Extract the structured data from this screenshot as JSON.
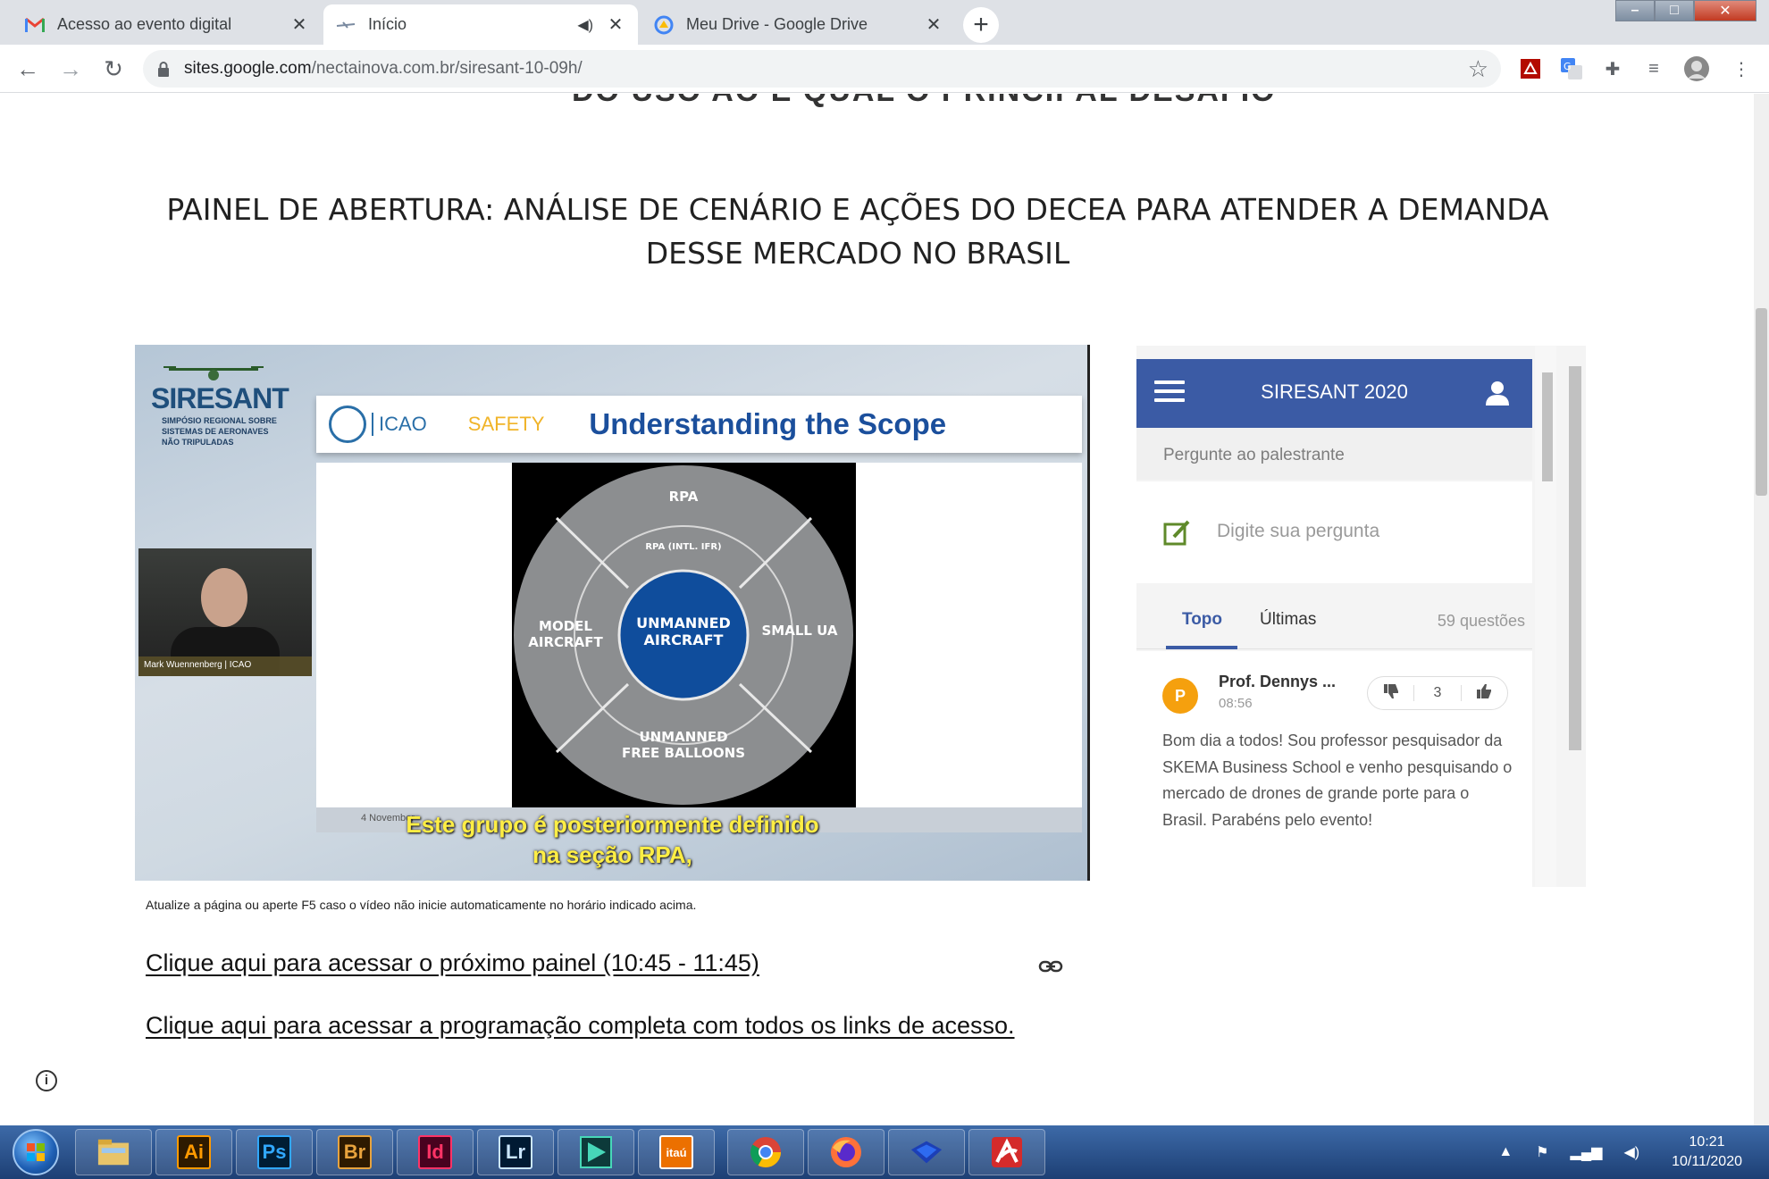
{
  "tabs": [
    {
      "title": "Acesso ao evento digital",
      "favicon": "gmail-icon",
      "active": false
    },
    {
      "title": "Início",
      "favicon": "sites-icon",
      "active": true
    },
    {
      "title": "Meu Drive - Google Drive",
      "favicon": "drive-icon",
      "active": false
    }
  ],
  "address": {
    "host": "sites.google.com",
    "path": "/nectainova.com.br/siresant-10-09h/"
  },
  "page": {
    "cut_heading": "DO USO AO E QUAL O PRINCIPAL DESAFIO",
    "heading": "PAINEL DE ABERTURA: ANÁLISE DE CENÁRIO E AÇÕES DO DECEA PARA ATENDER A DEMANDA DESSE MERCADO NO BRASIL",
    "notice": "Atualize a página ou aperte F5 caso o vídeo não inicie automaticamente no horário indicado acima.",
    "link_next_panel": "Clique aqui para acessar o próximo painel (10:45 - 11:45)",
    "link_program": "Clique aqui para acessar a programação completa com todos os links de acesso."
  },
  "video": {
    "logo_name": "SIRESANT",
    "logo_sub_1": "SIMPÓSIO REGIONAL SOBRE",
    "logo_sub_2": "SISTEMAS DE AERONAVES",
    "logo_sub_3": "NÃO TRIPULADAS",
    "speaker_caption": "Mark Wuennenberg | ICAO",
    "slide_org": "ICAO",
    "slide_tag": "SAFETY",
    "slide_title": "Understanding the Scope",
    "slide_footer": "4 November",
    "subtitle_line1": "Este grupo é posteriormente definido",
    "subtitle_line2": "na seção RPA,",
    "diagram": {
      "center": [
        "UNMANNED",
        "AIRCRAFT"
      ],
      "top": "RPA",
      "inner_top": "RPA (INTL. IFR)",
      "left": [
        "MODEL",
        "AIRCRAFT"
      ],
      "right": "SMALL UA",
      "bottom": [
        "UNMANNED",
        "FREE BALLOONS"
      ]
    }
  },
  "qa": {
    "title": "SIRESANT 2020",
    "ask_label": "Pergunte ao palestrante",
    "input_placeholder": "Digite sua pergunta",
    "tab_top": "Topo",
    "tab_latest": "Últimas",
    "count": "59 questões",
    "question": {
      "avatar": "P",
      "author": "Prof. Dennys ...",
      "time": "08:56",
      "votes": "3",
      "text": "Bom dia a todos! Sou professor pesquisador da SKEMA Business School e venho pesquisando o mercado de drones de grande porte para o Brasil. Parabéns pelo evento!"
    }
  },
  "taskbar": {
    "apps": [
      {
        "name": "explorer",
        "label": ""
      },
      {
        "name": "illustrator",
        "label": "Ai",
        "bg": "#2e1a00",
        "fg": "#ff9a00"
      },
      {
        "name": "photoshop",
        "label": "Ps",
        "bg": "#001d34",
        "fg": "#31a8ff"
      },
      {
        "name": "bridge",
        "label": "Br",
        "bg": "#2e1a00",
        "fg": "#e8a33d"
      },
      {
        "name": "indesign",
        "label": "Id",
        "bg": "#49021f",
        "fg": "#ff3366"
      },
      {
        "name": "lightroom",
        "label": "Lr",
        "bg": "#001a33",
        "fg": "#cbe6ff"
      },
      {
        "name": "video-app",
        "label": ""
      },
      {
        "name": "itau",
        "label": "itaú",
        "bg": "#ec7000",
        "fg": "#ffffff"
      },
      {
        "name": "chrome",
        "label": ""
      },
      {
        "name": "firefox",
        "label": ""
      },
      {
        "name": "shield-app",
        "label": ""
      },
      {
        "name": "antivirus",
        "label": ""
      }
    ],
    "time": "10:21",
    "date": "10/11/2020"
  }
}
